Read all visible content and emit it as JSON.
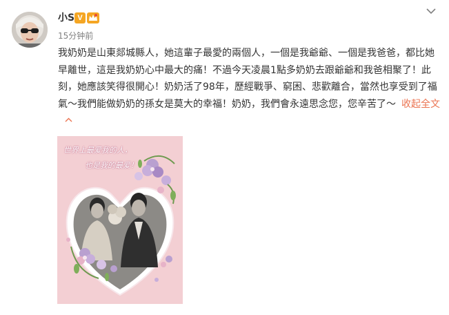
{
  "post": {
    "username": "小S",
    "verified_badge": "V",
    "timestamp": "15分钟前",
    "text": "我奶奶是山東郯城縣人，她這輩子最愛的兩個人，一個是我爺爺、一個是我爸爸，都比她早離世，這是我奶奶心中最大的痛！不過今天凌晨1點多奶奶去跟爺爺和我爸相聚了！此刻，她應該笑得很開心！奶奶活了98年，歷經戰爭、窮困、悲歡離合，當然也享受到了福氣～我們能做奶奶的孫女是莫大的幸福！奶奶，我們會永遠思念您，您辛苦了～",
    "collapse_label": "收起全文",
    "image": {
      "caption_line1": "世界上最爱我的人，",
      "caption_line2": "也是我的最爱！"
    }
  },
  "icons": {
    "menu": "chevron-down-icon",
    "collapse": "chevron-up-icon",
    "verified": "verified-v-icon",
    "member": "crown-icon"
  },
  "colors": {
    "link": "#eb7350",
    "badge": "#f5a623",
    "text": "#333333",
    "muted": "#808080",
    "photo_bg": "#f3cfd3"
  }
}
